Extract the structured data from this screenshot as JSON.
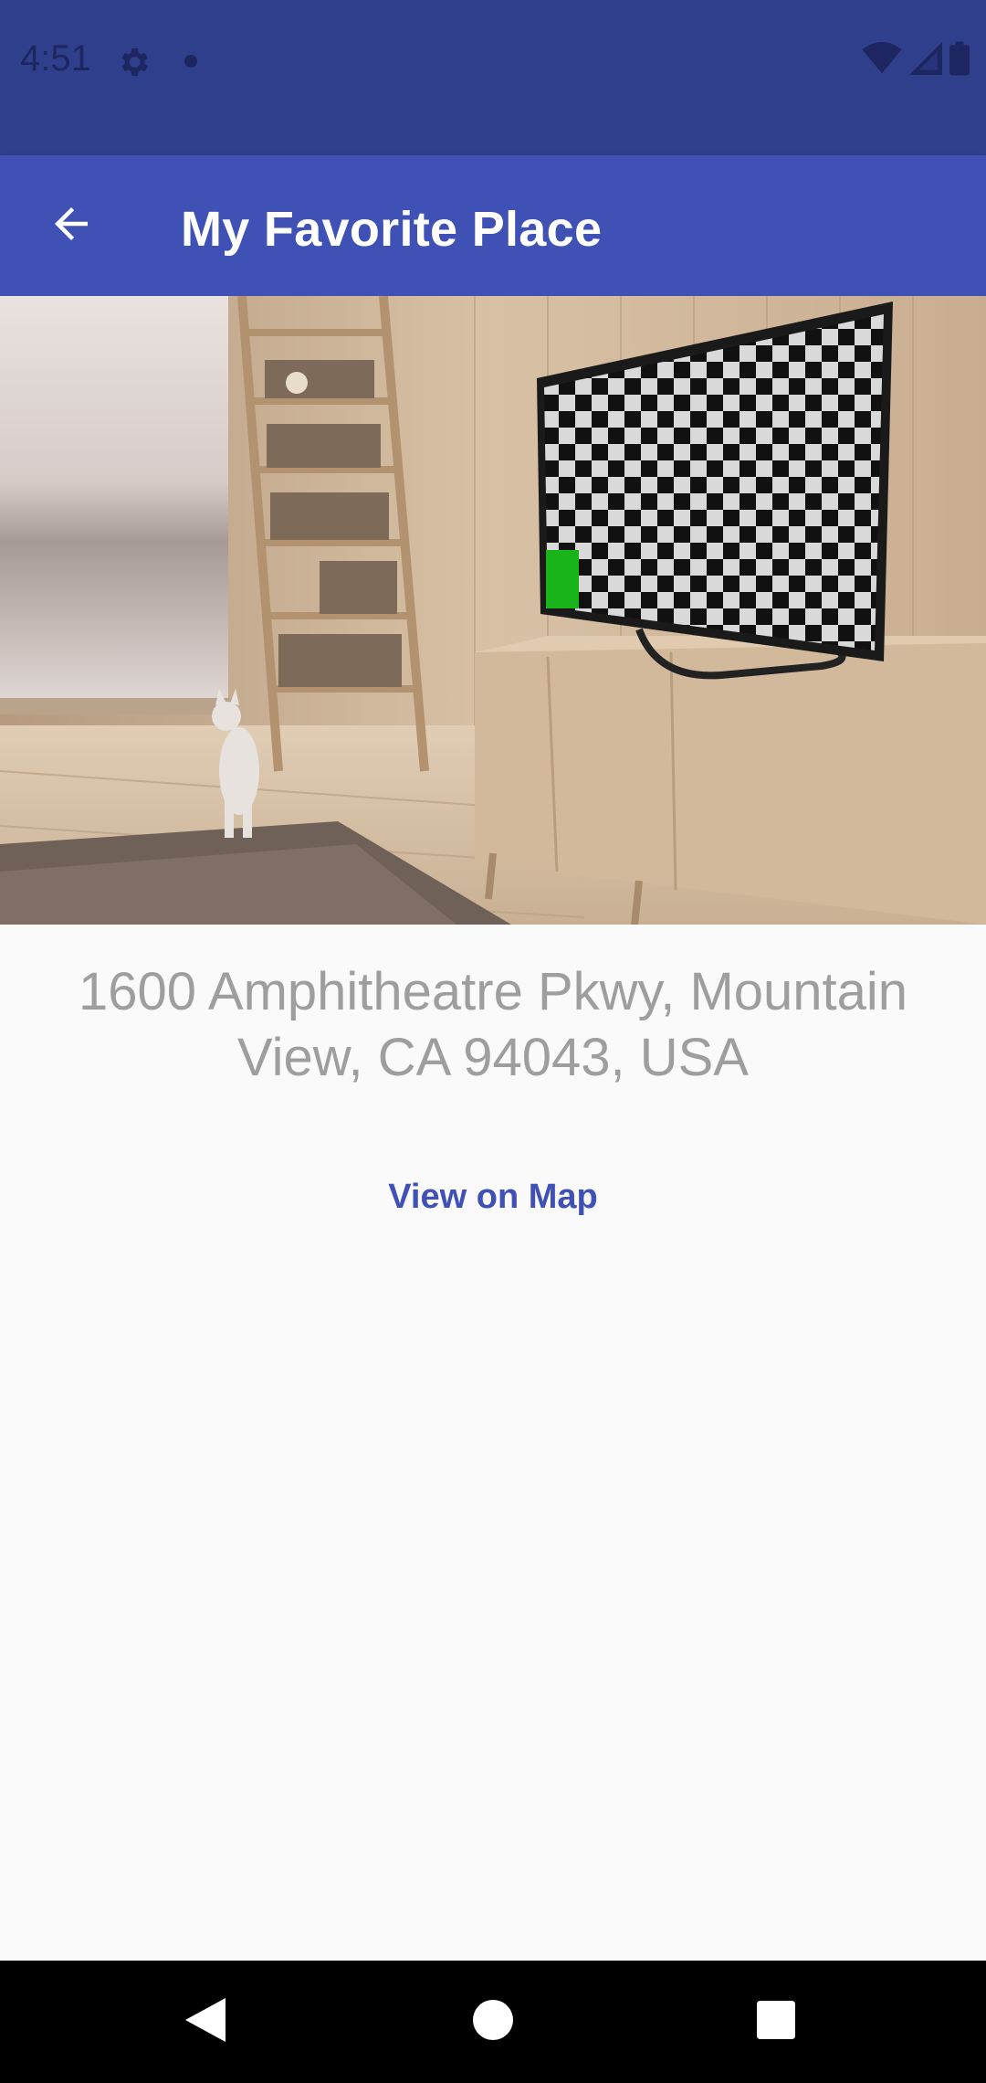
{
  "status_bar": {
    "time": "4:51",
    "icons": [
      "gear-icon",
      "notification-dot-icon",
      "wifi-icon",
      "signal-icon",
      "battery-icon"
    ]
  },
  "app_bar": {
    "title": "My Favorite Place",
    "back_icon": "arrow-back-icon",
    "background": "#3f51b5"
  },
  "place": {
    "address": "1600 Amphitheatre Pkwy, Mountain View, CA 94043, USA",
    "map_link_label": "View on Map"
  },
  "nav_bar": {
    "buttons": [
      "back-triangle-icon",
      "home-circle-icon",
      "recents-square-icon"
    ]
  },
  "colors": {
    "status_bar": "#303f8c",
    "app_bar": "#3f51b5",
    "accent": "#3f51b5",
    "address_text": "#9e9e9e"
  }
}
